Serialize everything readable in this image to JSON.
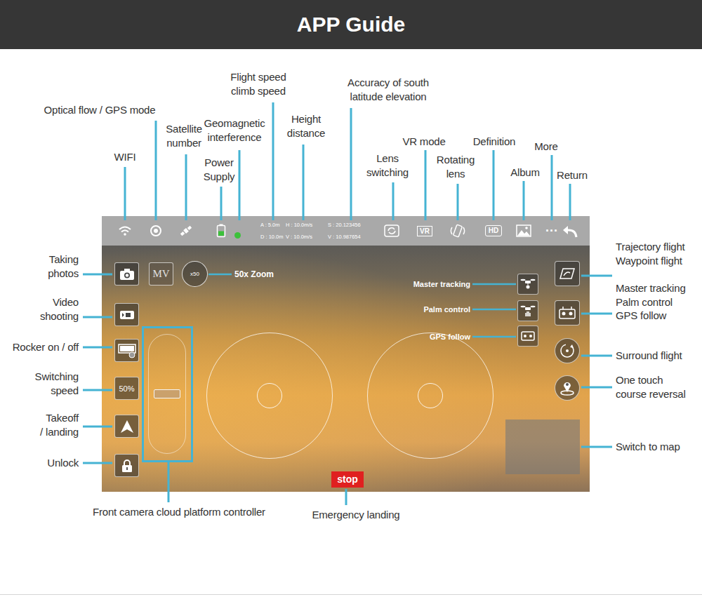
{
  "header": {
    "title": "APP Guide"
  },
  "status_bar": {
    "readings": [
      "A : 5.0m",
      "D : 10.0m",
      "H : 10.0m/s",
      "V : 10.0m/s",
      "S : 20.123456",
      "V : 10.987654"
    ],
    "vr": "VR",
    "hd": "HD",
    "more": "···",
    "battery_level": 0.5,
    "geomagnetic_ok": true
  },
  "controls": {
    "mv": "MV",
    "zoom": "x50",
    "speed": "50%",
    "stop": "stop"
  },
  "screen_labels": {
    "zoom": "50x Zoom",
    "modes": [
      "Master tracking",
      "Palm control",
      "GPS follow"
    ]
  },
  "callouts": [
    "WIFI",
    "Optical flow / GPS mode",
    "Satellite\nnumber",
    "Power\nSupply",
    "Geomagnetic\ninterference",
    "Flight speed\nclimb speed",
    "Height\ndistance",
    "Accuracy of south\nlatitude elevation",
    "Lens\nswitching",
    "VR mode",
    "Rotating\nlens",
    "Definition",
    "Album",
    "More",
    "Return",
    "Taking\nphotos",
    "Video\nshooting",
    "Rocker on / off",
    "Switching\nspeed",
    "Takeoff\n/ landing",
    "Unlock",
    "Trajectory flight\nWaypoint flight",
    "Master tracking\nPalm control\nGPS follow",
    "Surround flight",
    "One touch\ncourse reversal",
    "Switch to map",
    "Front camera cloud platform controller",
    "Emergency landing"
  ]
}
